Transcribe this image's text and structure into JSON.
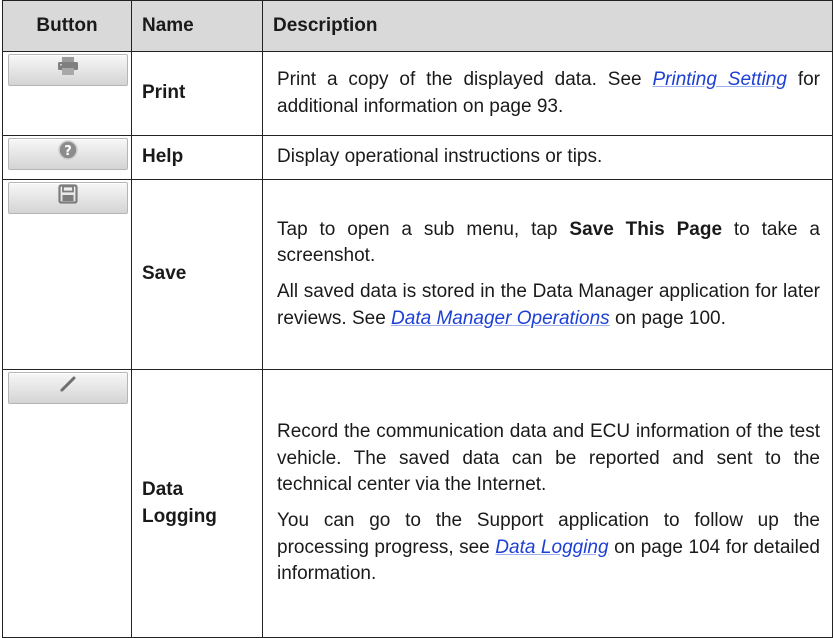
{
  "headers": {
    "button": "Button",
    "name": "Name",
    "description": "Description"
  },
  "rows": [
    {
      "icon": "printer-icon",
      "name": "Print",
      "desc": [
        {
          "pre": "Print a copy of the displayed data. See ",
          "link": "Printing Setting",
          "post": " for additional information on page 93."
        }
      ]
    },
    {
      "icon": "help-icon",
      "name": "Help",
      "desc": [
        {
          "pre": "Display operational instructions or tips."
        }
      ]
    },
    {
      "icon": "save-disk-icon",
      "name": "Save",
      "desc": [
        {
          "pre": "Tap to open a sub menu, tap ",
          "bold": "Save This Page",
          "post": " to take a screenshot."
        },
        {
          "pre": "All saved data is stored in the Data Manager application for later reviews. See ",
          "link": "Data Manager Operations",
          "post": " on page 100."
        }
      ]
    },
    {
      "icon": "pencil-icon",
      "name": "Data Logging",
      "desc": [
        {
          "pre": "Record the communication data and ECU information of the test vehicle. The saved data can be reported and sent to the technical center via the Internet."
        },
        {
          "pre": "You can go to the Support application to follow up the processing progress, see ",
          "link": "Data Logging",
          "post": " on page 104 for detailed information."
        }
      ]
    }
  ]
}
